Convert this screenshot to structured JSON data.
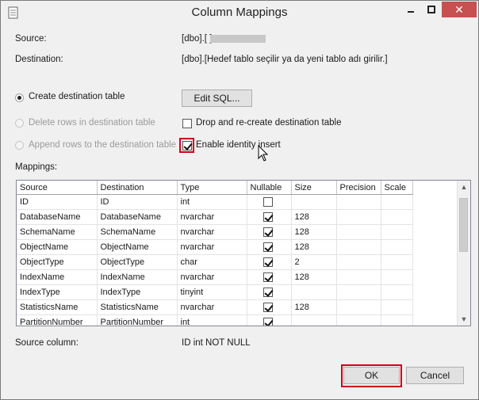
{
  "window": {
    "title": "Column Mappings",
    "close_glyph": "✕",
    "accent_highlight": "#d0021b"
  },
  "source": {
    "label": "Source:",
    "value": "[dbo].[                    ]"
  },
  "destination": {
    "label": "Destination:",
    "value": "[dbo].[Hedef tablo seçilir ya da yeni tablo adı girilir.]"
  },
  "options": {
    "create_table": "Create destination table",
    "delete_rows": "Delete rows in destination table",
    "append_rows": "Append rows to the destination table",
    "edit_sql": "Edit SQL...",
    "drop_recreate": "Drop and re-create destination table",
    "identity_insert": "Enable identity insert"
  },
  "mappings": {
    "label": "Mappings:",
    "headers": [
      "Source",
      "Destination",
      "Type",
      "Nullable",
      "Size",
      "Precision",
      "Scale"
    ],
    "rows": [
      {
        "source": "ID",
        "destination": "ID",
        "type": "int",
        "nullable": false,
        "size": ""
      },
      {
        "source": "DatabaseName",
        "destination": "DatabaseName",
        "type": "nvarchar",
        "nullable": true,
        "size": "128"
      },
      {
        "source": "SchemaName",
        "destination": "SchemaName",
        "type": "nvarchar",
        "nullable": true,
        "size": "128"
      },
      {
        "source": "ObjectName",
        "destination": "ObjectName",
        "type": "nvarchar",
        "nullable": true,
        "size": "128"
      },
      {
        "source": "ObjectType",
        "destination": "ObjectType",
        "type": "char",
        "nullable": true,
        "size": "2"
      },
      {
        "source": "IndexName",
        "destination": "IndexName",
        "type": "nvarchar",
        "nullable": true,
        "size": "128"
      },
      {
        "source": "IndexType",
        "destination": "IndexType",
        "type": "tinyint",
        "nullable": true,
        "size": ""
      },
      {
        "source": "StatisticsName",
        "destination": "StatisticsName",
        "type": "nvarchar",
        "nullable": true,
        "size": "128"
      },
      {
        "source": "PartitionNumber",
        "destination": "PartitionNumber",
        "type": "int",
        "nullable": true,
        "size": ""
      }
    ]
  },
  "source_column": {
    "label": "Source column:",
    "value": "ID int NOT NULL"
  },
  "buttons": {
    "ok": "OK",
    "cancel": "Cancel"
  }
}
